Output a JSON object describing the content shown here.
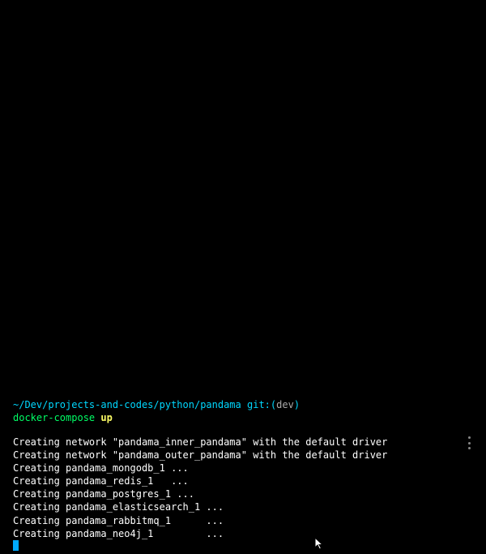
{
  "menu": {
    "name": "vertical-dots-menu"
  },
  "prompt": {
    "path": "~/Dev/projects-and-codes/python/pandama",
    "git_prefix": " git:(",
    "git_branch": "dev",
    "git_suffix": ")"
  },
  "command": {
    "name": "docker-compose",
    "arg": " up"
  },
  "output": [
    "Creating network \"pandama_inner_pandama\" with the default driver",
    "Creating network \"pandama_outer_pandama\" with the default driver",
    "Creating pandama_mongodb_1 ...",
    "Creating pandama_redis_1   ...",
    "Creating pandama_postgres_1 ...",
    "Creating pandama_elasticsearch_1 ...",
    "Creating pandama_rabbitmq_1      ...",
    "Creating pandama_neo4j_1         ..."
  ]
}
